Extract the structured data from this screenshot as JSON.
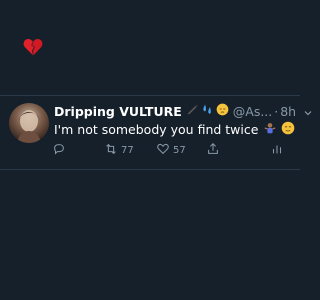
{
  "top_emoji": {
    "name": "broken-heart-icon"
  },
  "tweet": {
    "display_name": "Dripping VULTURE",
    "name_emojis": [
      "bird-icon",
      "sweat-droplets-icon",
      "pensive-face-icon"
    ],
    "handle": "@As...",
    "separator": "·",
    "time": "8h",
    "text": "I'm not somebody you find twice",
    "text_emojis": [
      "person-shrugging-icon",
      "relieved-face-icon"
    ],
    "actions": {
      "reply_count": "",
      "retweet_count": "77",
      "like_count": "57"
    }
  },
  "colors": {
    "background": "#15202b",
    "secondary_text": "#8899a6",
    "divider": "#2b3a48"
  }
}
